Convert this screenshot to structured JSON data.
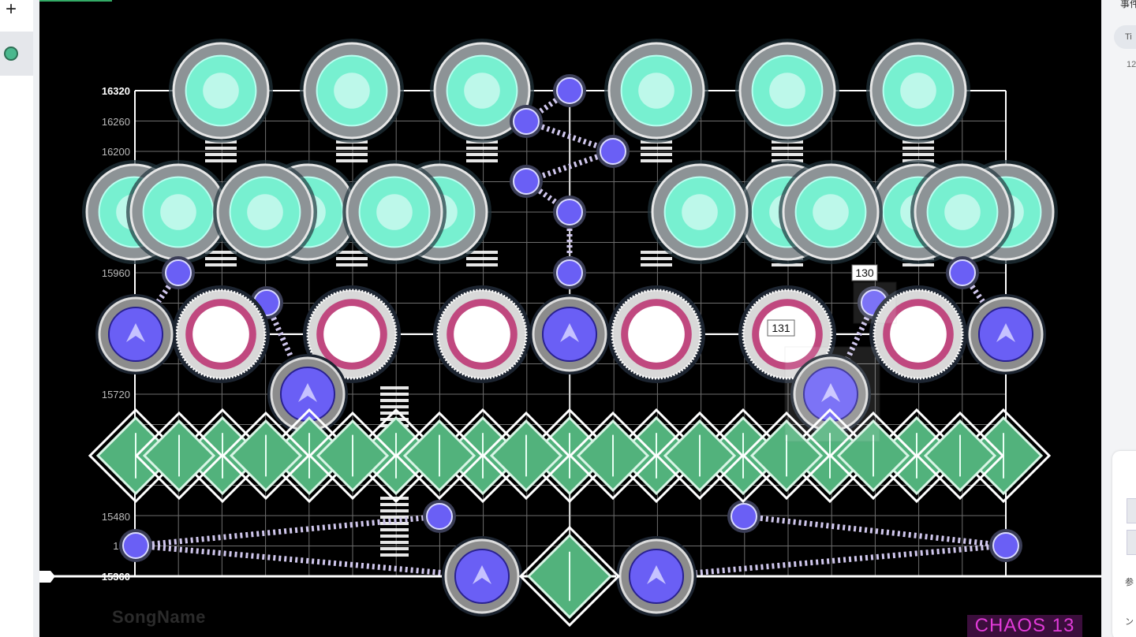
{
  "sidebar_left": {
    "add_label": "+"
  },
  "right_panel": {
    "title": "事件",
    "chip": "Ti",
    "number": "12",
    "ref_label": "参",
    "bottom_label": "ン"
  },
  "chart_view": {
    "y_labels": [
      {
        "value": "16320",
        "bold": true
      },
      {
        "value": "16260",
        "bold": false
      },
      {
        "value": "16200",
        "bold": false
      },
      {
        "value": "15960",
        "bold": false
      },
      {
        "value": "15720",
        "bold": false
      },
      {
        "value": "15480",
        "bold": false
      },
      {
        "value": "154",
        "bold": false
      },
      {
        "value": "15360",
        "bold": true
      }
    ],
    "note_labels": [
      "130",
      "131"
    ],
    "song_name": "SongName",
    "difficulty": "CHAOS 13"
  },
  "colors": {
    "canvas_bg": "#000000",
    "tap_fill": "#77f0d0",
    "flick_fill": "#6a5ff5",
    "hold_fill": "#ffffff",
    "hold_ring": "#c0487f",
    "drag_fill": "#52b27c",
    "connector": "#cfc6ec",
    "difficulty_text": "#e23bd9",
    "difficulty_bg": "#3b0e3c"
  },
  "icons": {
    "add": "plus-icon",
    "note_dot": "circle-icon",
    "playhead": "playhead-marker-icon"
  }
}
